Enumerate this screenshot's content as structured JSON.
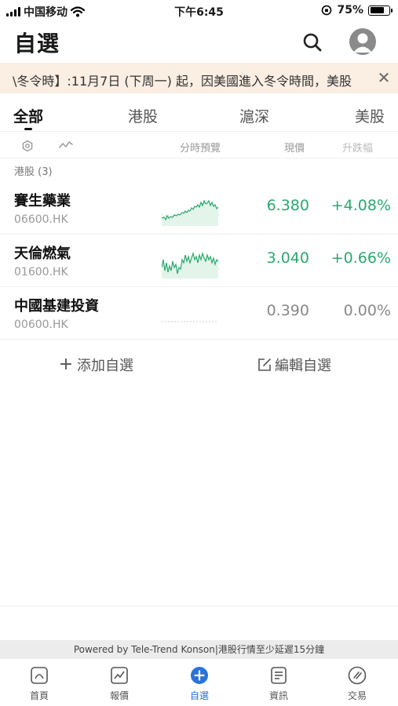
{
  "status_bar": {
    "carrier": "中国移动",
    "time": "下午6:45",
    "battery": "75%",
    "battery_level": 0.75
  },
  "header": {
    "title": "自選",
    "search_icon": "search-icon",
    "avatar_icon": "user-avatar-icon"
  },
  "notice": {
    "text": "\\冬令時】:11月7日 (下周一) 起，因美國進入冬令時間，美股",
    "close_icon": "close-icon"
  },
  "tabs": [
    {
      "label": "全部",
      "active": true
    },
    {
      "label": "港股",
      "active": false
    },
    {
      "label": "滬深",
      "active": false
    },
    {
      "label": "美股",
      "active": false
    }
  ],
  "columns": {
    "settings_icon": "settings-icon",
    "trend_icon": "trend-icon",
    "preview": "分時預覽",
    "price": "現價",
    "change": "升跌幅"
  },
  "section": {
    "label": "港股 (3)"
  },
  "stocks": [
    {
      "name": "賽生藥業",
      "code": "06600.HK",
      "price": "6.380",
      "change": "+4.08%",
      "trend": "up"
    },
    {
      "name": "天倫燃氣",
      "code": "01600.HK",
      "price": "3.040",
      "change": "+0.66%",
      "trend": "up"
    },
    {
      "name": "中國基建投資",
      "code": "00600.HK",
      "price": "0.390",
      "change": "0.00%",
      "trend": "flat"
    }
  ],
  "actions": {
    "add_label": "添加自選",
    "edit_label": "編輯自選"
  },
  "footer_note": "Powered by Tele-Trend Konson|港股行情至少延遲15分鐘",
  "bottom_nav": [
    {
      "label": "首頁",
      "icon": "home-icon",
      "active": false
    },
    {
      "label": "報價",
      "icon": "quote-chart-icon",
      "active": false
    },
    {
      "label": "自選",
      "icon": "add-circle-icon",
      "active": true
    },
    {
      "label": "資訊",
      "icon": "news-icon",
      "active": false
    },
    {
      "label": "交易",
      "icon": "trade-icon",
      "active": false
    }
  ],
  "colors": {
    "up": "#2aa96e",
    "flat": "#888888",
    "accent": "#2a73d9",
    "notice_bg": "#fbeee3"
  }
}
